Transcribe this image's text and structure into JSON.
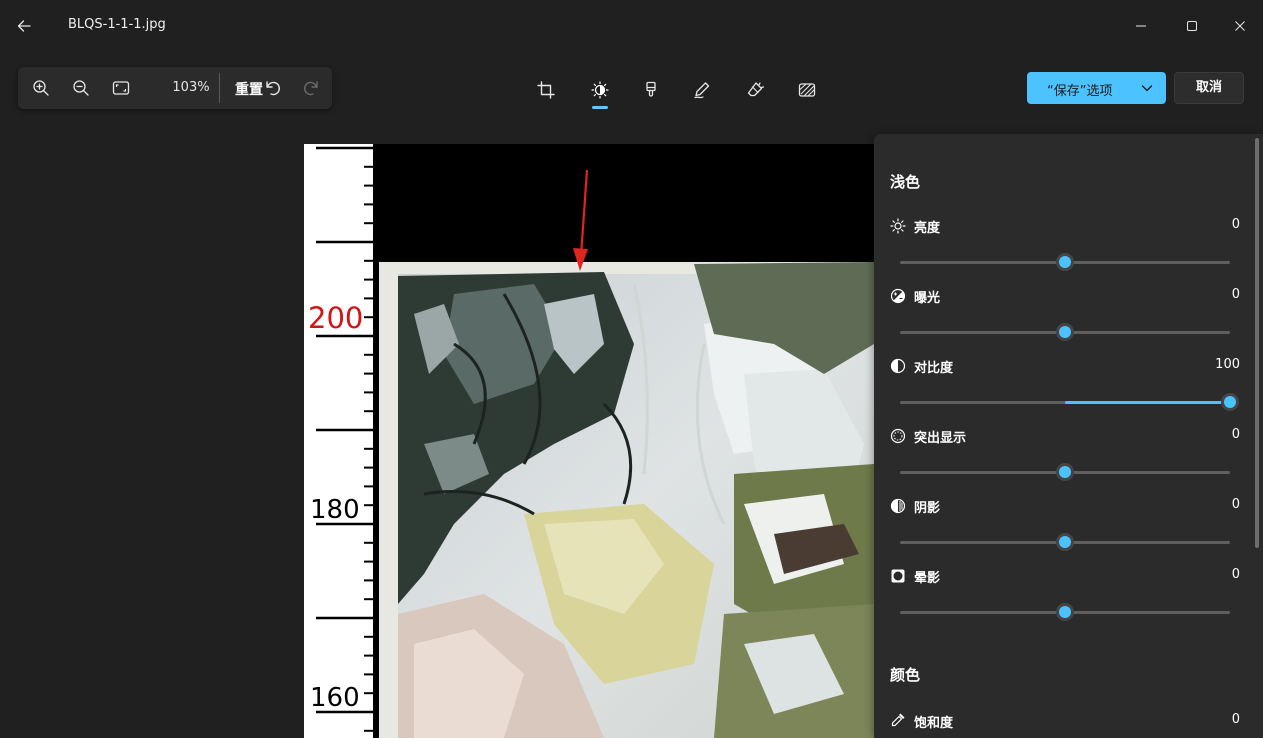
{
  "titlebar": {
    "filename": "BLQS-1-1-1.jpg",
    "icons": [
      "back-arrow-icon",
      "minimize-icon",
      "maximize-icon",
      "close-icon"
    ]
  },
  "toolbar": {
    "zoom_percent": "103%",
    "reset_label": "重置",
    "icons": [
      "zoom-in-icon",
      "zoom-out-icon",
      "fit-to-window-icon",
      "undo-icon",
      "redo-icon"
    ]
  },
  "tools": {
    "active": "adjust",
    "items": [
      "crop-icon",
      "adjust-icon",
      "filter-icon",
      "markup-icon",
      "erase-icon",
      "background-blur-icon"
    ]
  },
  "actions": {
    "save_options_label": "“保存”选项",
    "cancel_label": "取消"
  },
  "colors": {
    "accent": "#4cc2ff",
    "background": "#202020",
    "panel": "#2b2b2b"
  },
  "image": {
    "ruler_labels": [
      "200",
      "180",
      "160"
    ]
  },
  "panel": {
    "light_title": "浅色",
    "color_title": "颜色",
    "adjustments": [
      {
        "label": "亮度",
        "value": "0",
        "icon": "brightness-icon",
        "level": 0,
        "min": -100,
        "max": 100
      },
      {
        "label": "曝光",
        "value": "0",
        "icon": "exposure-icon",
        "level": 0,
        "min": -100,
        "max": 100
      },
      {
        "label": "对比度",
        "value": "100",
        "icon": "contrast-icon",
        "level": 100,
        "min": -100,
        "max": 100
      },
      {
        "label": "突出显示",
        "value": "0",
        "icon": "highlights-icon",
        "level": 0,
        "min": -100,
        "max": 100
      },
      {
        "label": "阴影",
        "value": "0",
        "icon": "shadows-icon",
        "level": 0,
        "min": -100,
        "max": 100
      },
      {
        "label": "晕影",
        "value": "0",
        "icon": "vignette-icon",
        "level": 0,
        "min": -100,
        "max": 100
      }
    ],
    "color_adjustments": [
      {
        "label": "饱和度",
        "value": "0",
        "icon": "saturation-icon"
      }
    ]
  }
}
